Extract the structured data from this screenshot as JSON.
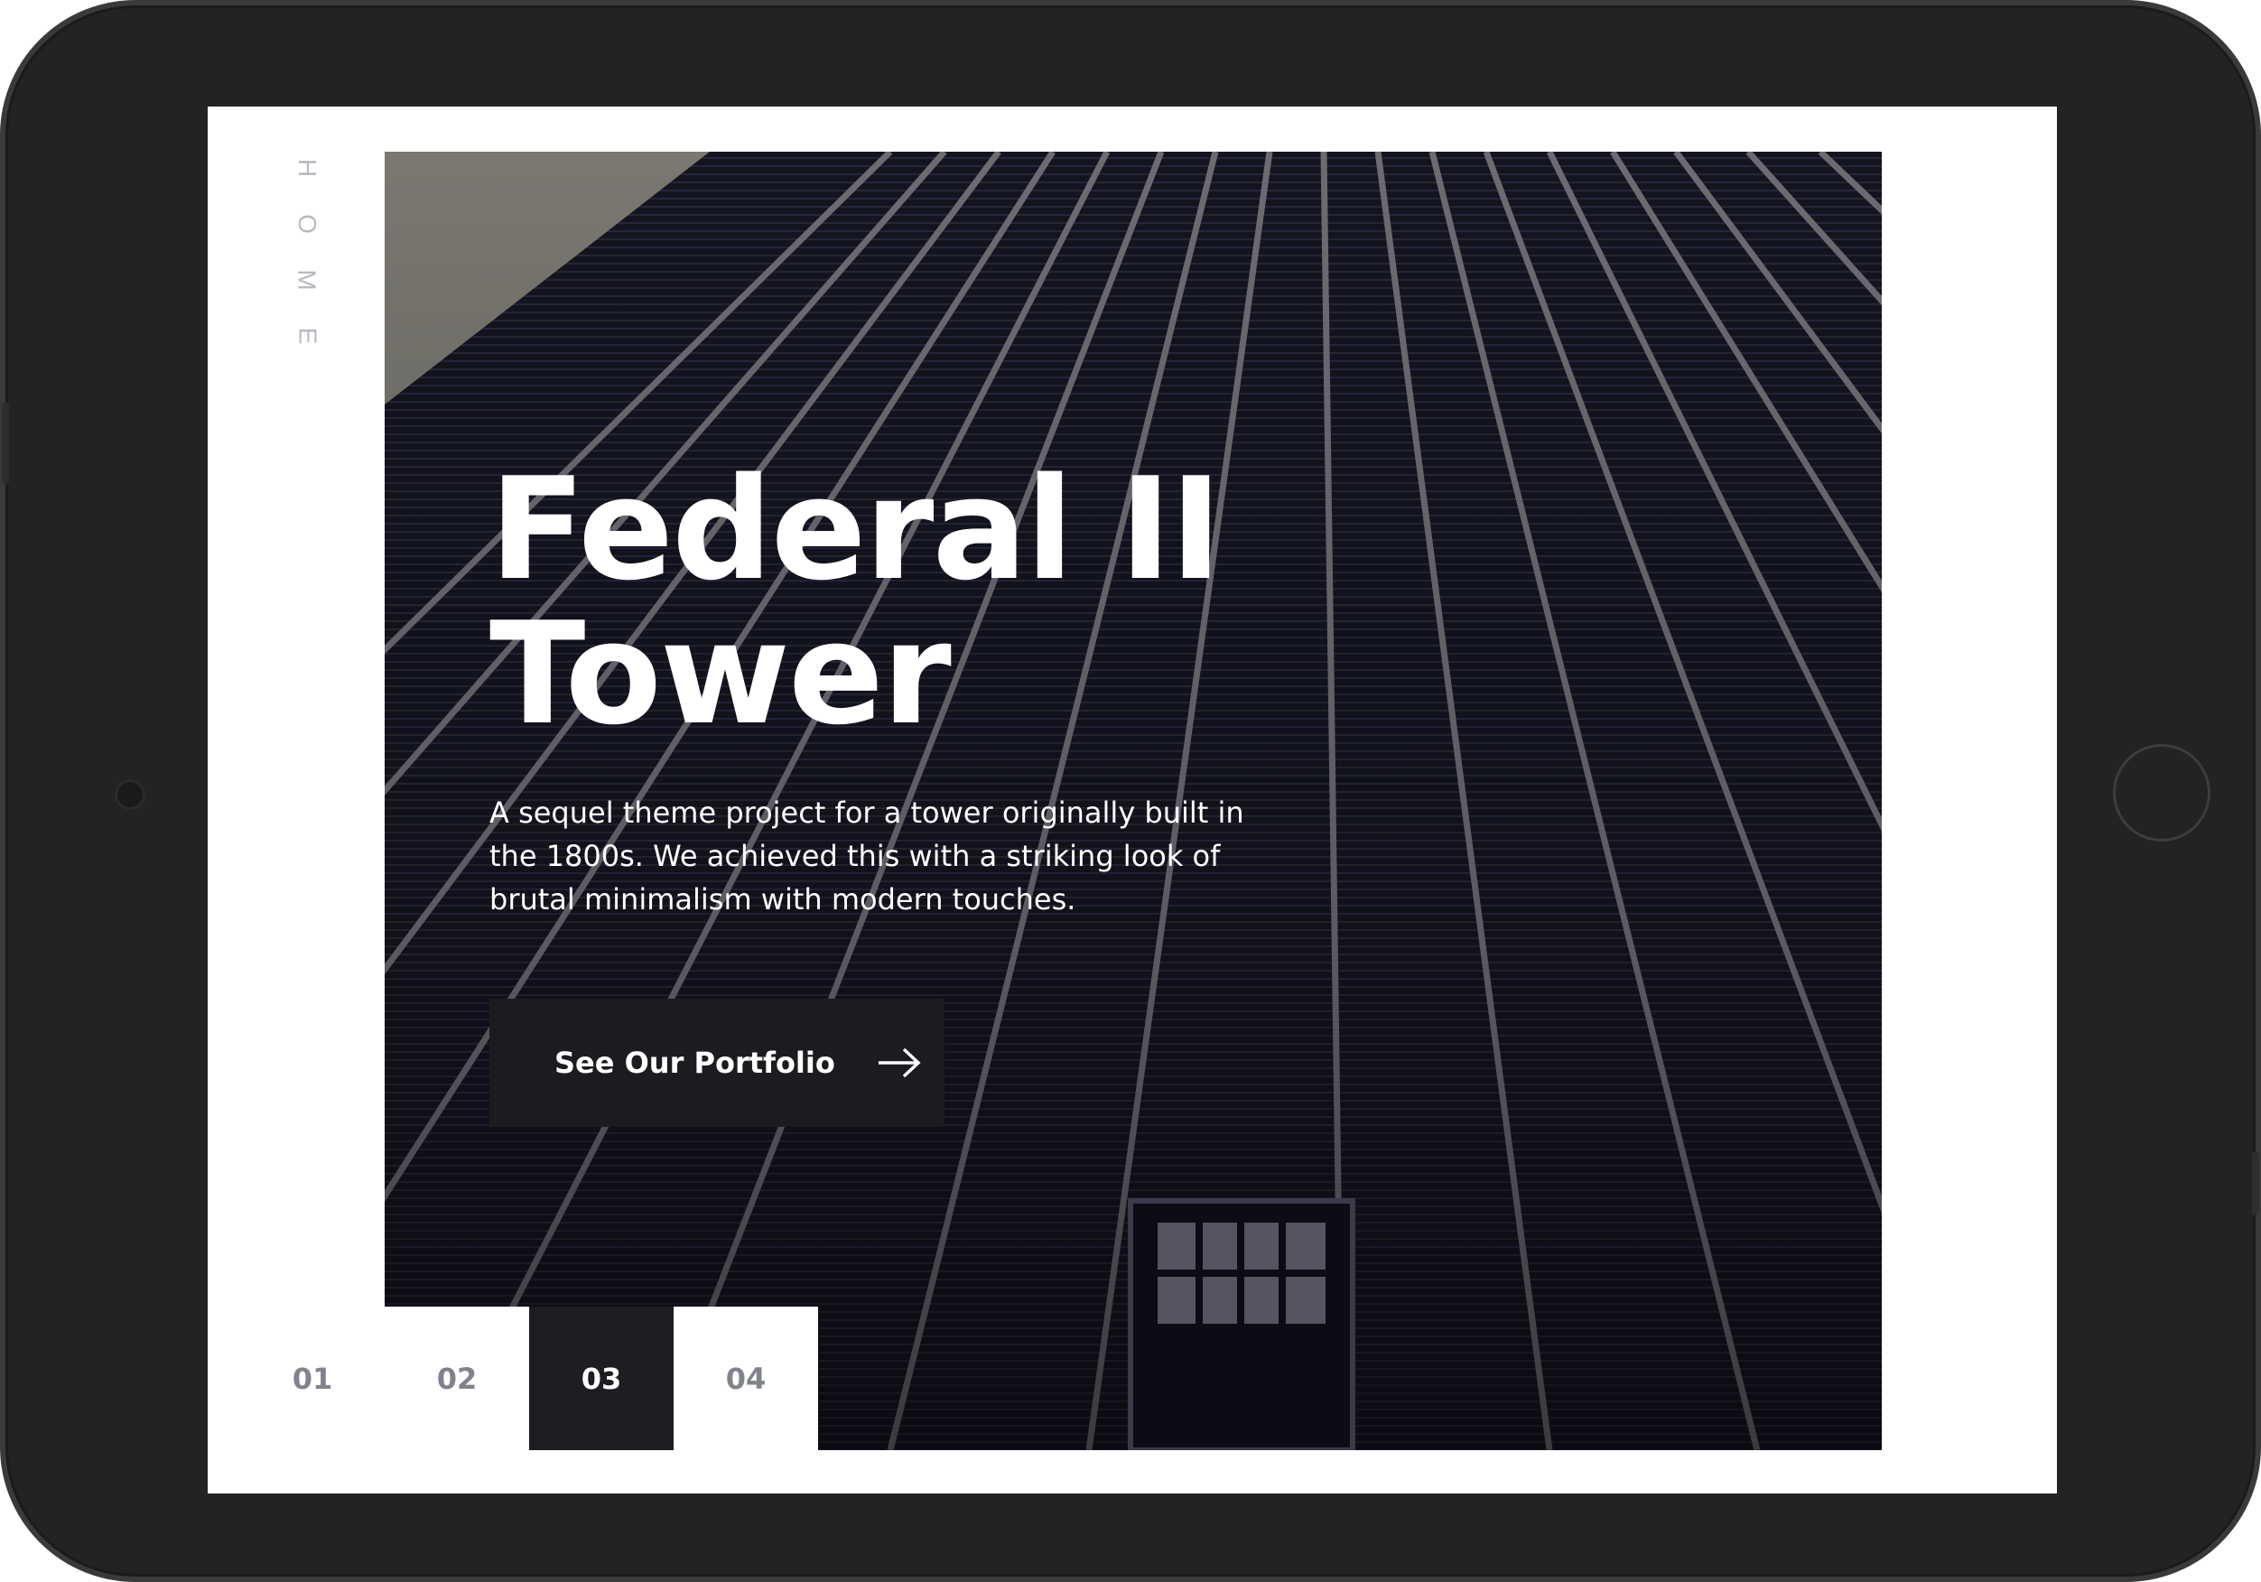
{
  "nav": {
    "vertical_letters": [
      "H",
      "O",
      "M",
      "E"
    ]
  },
  "hero": {
    "title": "Federal II\nTower",
    "description": "A sequel theme project for a tower originally built in the 1800s. We achieved this with a striking look of brutal minimalism with modern touches.",
    "cta_label": "See Our Portfolio",
    "cta_icon": "arrow-right-icon"
  },
  "pagination": {
    "pages": [
      "01",
      "02",
      "03",
      "04"
    ],
    "active": "03"
  },
  "colors": {
    "accent_dark": "#1d1e21",
    "inactive_page_text": "#80838c",
    "nav_text": "#b7b9c0"
  }
}
